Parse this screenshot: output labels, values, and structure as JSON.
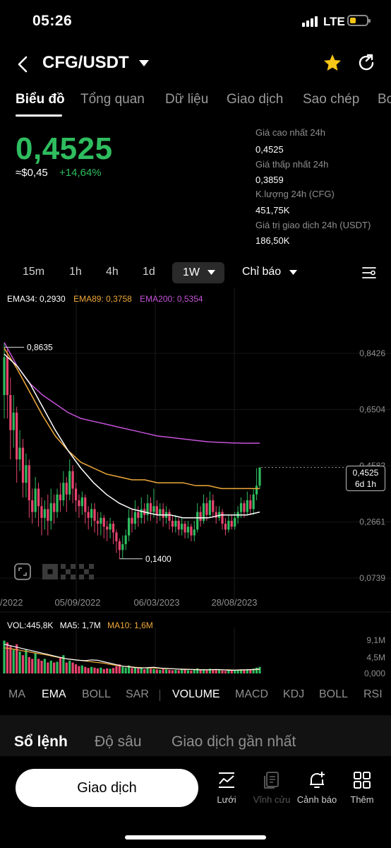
{
  "status_bar": {
    "time": "05:26",
    "network": "LTE",
    "battery_level": 0.35
  },
  "header": {
    "title": "CFG/USDT",
    "icons": [
      "back-icon",
      "chevron-down-icon",
      "star-icon",
      "share-icon"
    ],
    "favorite_color": "#f5c518"
  },
  "tabs": [
    "Biểu đồ",
    "Tổng quan",
    "Dữ liệu",
    "Giao dịch",
    "Sao chép",
    "Bo"
  ],
  "price": {
    "last": "0,4525",
    "fiat": "≈$0,45",
    "change": "+14,64%",
    "color": "#2ebd5f"
  },
  "stats": [
    {
      "label": "Giá cao nhất 24h",
      "value": "0,4525"
    },
    {
      "label": "Giá thấp nhất 24h",
      "value": "0,3859"
    },
    {
      "label": "K.lượng 24h (CFG)",
      "value": "451,75K"
    },
    {
      "label": "Giá trị giao dịch 24h (USDT)",
      "value": "186,50K"
    }
  ],
  "timeframes": [
    "15m",
    "1h",
    "4h",
    "1d"
  ],
  "timeframe_selected": "1W",
  "indicator_button": "Chỉ báo",
  "chart_data": {
    "type": "candlestick",
    "ema_legend": [
      {
        "label": "EMA34: 0,2930",
        "color": "#ffffff"
      },
      {
        "label": "EMA89: 0,3758",
        "color": "#f0a93a"
      },
      {
        "label": "EMA200: 0,5354",
        "color": "#c552d9"
      }
    ],
    "y_ticks": [
      "0,8426",
      "0,6504",
      "0,4582",
      "0,2661",
      "0,0739"
    ],
    "x_ticks": [
      "/2022",
      "05/09/2022",
      "06/03/2023",
      "28/08/2023"
    ],
    "annotations": {
      "high": "0,8635",
      "low": "0,1400"
    },
    "last_price_tag": {
      "price": "0,4525",
      "countdown": "6d 1h"
    },
    "up_color": "#2ebd5f",
    "down_color": "#e8456f",
    "ylim": [
      0.0739,
      0.8426
    ],
    "candles": [
      [
        0.7,
        0.83,
        0.88,
        0.62
      ],
      [
        0.83,
        0.7,
        0.86,
        0.62
      ],
      [
        0.7,
        0.58,
        0.76,
        0.48
      ],
      [
        0.58,
        0.64,
        0.7,
        0.52
      ],
      [
        0.64,
        0.48,
        0.66,
        0.4
      ],
      [
        0.48,
        0.52,
        0.58,
        0.44
      ],
      [
        0.52,
        0.4,
        0.55,
        0.35
      ],
      [
        0.4,
        0.46,
        0.5,
        0.35
      ],
      [
        0.46,
        0.34,
        0.48,
        0.28
      ],
      [
        0.34,
        0.3,
        0.38,
        0.26
      ],
      [
        0.3,
        0.38,
        0.42,
        0.28
      ],
      [
        0.38,
        0.32,
        0.4,
        0.25
      ],
      [
        0.32,
        0.28,
        0.35,
        0.22
      ],
      [
        0.28,
        0.31,
        0.34,
        0.24
      ],
      [
        0.31,
        0.27,
        0.36,
        0.22
      ],
      [
        0.27,
        0.33,
        0.38,
        0.24
      ],
      [
        0.33,
        0.3,
        0.36,
        0.26
      ],
      [
        0.3,
        0.36,
        0.38,
        0.28
      ],
      [
        0.36,
        0.34,
        0.4,
        0.3
      ],
      [
        0.34,
        0.4,
        0.44,
        0.32
      ],
      [
        0.4,
        0.36,
        0.42,
        0.3
      ],
      [
        0.36,
        0.44,
        0.48,
        0.34
      ],
      [
        0.44,
        0.38,
        0.46,
        0.33
      ],
      [
        0.38,
        0.34,
        0.4,
        0.3
      ],
      [
        0.34,
        0.32,
        0.36,
        0.28
      ],
      [
        0.32,
        0.35,
        0.37,
        0.29
      ],
      [
        0.35,
        0.3,
        0.36,
        0.26
      ],
      [
        0.3,
        0.28,
        0.32,
        0.24
      ],
      [
        0.28,
        0.31,
        0.33,
        0.25
      ],
      [
        0.31,
        0.27,
        0.33,
        0.23
      ],
      [
        0.27,
        0.26,
        0.3,
        0.22
      ],
      [
        0.26,
        0.28,
        0.3,
        0.22
      ],
      [
        0.28,
        0.25,
        0.29,
        0.21
      ],
      [
        0.25,
        0.24,
        0.27,
        0.2
      ],
      [
        0.24,
        0.26,
        0.28,
        0.21
      ],
      [
        0.26,
        0.23,
        0.27,
        0.19
      ],
      [
        0.23,
        0.2,
        0.24,
        0.16
      ],
      [
        0.2,
        0.17,
        0.21,
        0.14
      ],
      [
        0.17,
        0.19,
        0.22,
        0.14
      ],
      [
        0.19,
        0.22,
        0.24,
        0.17
      ],
      [
        0.22,
        0.28,
        0.31,
        0.2
      ],
      [
        0.28,
        0.26,
        0.31,
        0.23
      ],
      [
        0.26,
        0.3,
        0.34,
        0.24
      ],
      [
        0.3,
        0.28,
        0.32,
        0.25
      ],
      [
        0.28,
        0.31,
        0.35,
        0.26
      ],
      [
        0.31,
        0.29,
        0.33,
        0.26
      ],
      [
        0.29,
        0.33,
        0.36,
        0.27
      ],
      [
        0.33,
        0.3,
        0.35,
        0.27
      ],
      [
        0.3,
        0.32,
        0.38,
        0.28
      ],
      [
        0.32,
        0.29,
        0.34,
        0.26
      ],
      [
        0.29,
        0.31,
        0.33,
        0.27
      ],
      [
        0.31,
        0.28,
        0.33,
        0.25
      ],
      [
        0.28,
        0.3,
        0.32,
        0.26
      ],
      [
        0.3,
        0.27,
        0.31,
        0.24
      ],
      [
        0.27,
        0.25,
        0.29,
        0.23
      ],
      [
        0.25,
        0.27,
        0.29,
        0.23
      ],
      [
        0.27,
        0.24,
        0.28,
        0.22
      ],
      [
        0.24,
        0.26,
        0.28,
        0.22
      ],
      [
        0.26,
        0.23,
        0.27,
        0.21
      ],
      [
        0.23,
        0.25,
        0.27,
        0.21
      ],
      [
        0.25,
        0.22,
        0.26,
        0.2
      ],
      [
        0.22,
        0.24,
        0.27,
        0.2
      ],
      [
        0.24,
        0.3,
        0.33,
        0.23
      ],
      [
        0.3,
        0.27,
        0.32,
        0.25
      ],
      [
        0.27,
        0.33,
        0.36,
        0.26
      ],
      [
        0.33,
        0.29,
        0.35,
        0.27
      ],
      [
        0.29,
        0.34,
        0.37,
        0.28
      ],
      [
        0.34,
        0.3,
        0.36,
        0.28
      ],
      [
        0.3,
        0.28,
        0.32,
        0.26
      ],
      [
        0.28,
        0.3,
        0.32,
        0.27
      ],
      [
        0.3,
        0.26,
        0.31,
        0.24
      ],
      [
        0.26,
        0.24,
        0.28,
        0.22
      ],
      [
        0.24,
        0.27,
        0.29,
        0.23
      ],
      [
        0.27,
        0.25,
        0.29,
        0.24
      ],
      [
        0.25,
        0.28,
        0.3,
        0.24
      ],
      [
        0.28,
        0.3,
        0.32,
        0.26
      ],
      [
        0.3,
        0.33,
        0.35,
        0.28
      ],
      [
        0.33,
        0.3,
        0.34,
        0.28
      ],
      [
        0.3,
        0.34,
        0.37,
        0.29
      ],
      [
        0.34,
        0.31,
        0.36,
        0.29
      ],
      [
        0.31,
        0.36,
        0.38,
        0.29
      ],
      [
        0.36,
        0.39,
        0.45,
        0.34
      ],
      [
        0.39,
        0.4525,
        0.4525,
        0.38
      ]
    ],
    "ema34": [
      0.84,
      0.8,
      0.74,
      0.66,
      0.58,
      0.51,
      0.45,
      0.4,
      0.36,
      0.33,
      0.31,
      0.3,
      0.29,
      0.29,
      0.28,
      0.28,
      0.28,
      0.29,
      0.29,
      0.29,
      0.3
    ],
    "ema89": [
      0.86,
      0.79,
      0.71,
      0.63,
      0.56,
      0.51,
      0.47,
      0.45,
      0.43,
      0.42,
      0.41,
      0.41,
      0.4,
      0.4,
      0.4,
      0.39,
      0.39,
      0.38,
      0.38,
      0.38,
      0.38
    ],
    "ema200": [
      0.88,
      0.8,
      0.74,
      0.7,
      0.67,
      0.64,
      0.62,
      0.61,
      0.6,
      0.59,
      0.58,
      0.57,
      0.56,
      0.555,
      0.55,
      0.545,
      0.54,
      0.538,
      0.536,
      0.535,
      0.5354
    ],
    "volume_legend": [
      {
        "label": "VOL:445,8K",
        "color": "#ffffff"
      },
      {
        "label": "MA5: 1,7M",
        "color": "#ffffff"
      },
      {
        "label": "MA10: 1,6M",
        "color": "#f0a93a"
      }
    ],
    "volume_ticks": [
      "9,1M",
      "4,5M",
      "0,000"
    ],
    "volume_max": 9.1,
    "volumes": [
      9.0,
      8.5,
      7.5,
      6.5,
      8.0,
      6.0,
      5.0,
      6.5,
      4.5,
      4.0,
      5.5,
      4.0,
      3.5,
      4.0,
      3.0,
      3.5,
      3.0,
      3.2,
      4.5,
      5.0,
      3.0,
      3.5,
      3.0,
      2.5,
      2.0,
      2.2,
      1.8,
      1.5,
      1.8,
      1.6,
      1.4,
      1.6,
      1.2,
      1.4,
      1.3,
      1.5,
      2.0,
      2.5,
      1.8,
      1.6,
      2.2,
      1.5,
      1.6,
      1.4,
      1.5,
      1.2,
      1.4,
      1.3,
      1.2,
      1.1,
      1.0,
      1.2,
      1.1,
      1.0,
      0.9,
      1.0,
      0.9,
      1.1,
      1.0,
      0.9,
      0.8,
      1.0,
      1.4,
      1.0,
      1.2,
      1.0,
      1.3,
      1.0,
      0.9,
      1.0,
      0.8,
      0.7,
      0.9,
      0.8,
      0.9,
      1.0,
      1.1,
      0.9,
      1.2,
      1.0,
      1.3,
      1.6,
      1.8
    ],
    "vol_ma5": [
      8.0,
      7.6,
      7.2,
      6.8,
      6.4,
      6.0,
      5.6,
      5.2,
      4.8,
      4.4,
      4.0,
      3.8,
      3.6,
      3.5,
      3.7,
      3.6,
      3.2,
      2.8,
      2.4,
      2.0,
      1.8,
      1.6,
      1.5,
      1.6,
      1.7,
      1.5,
      1.4,
      1.3,
      1.2,
      1.1,
      1.1,
      1.0,
      1.0,
      1.0,
      1.1,
      1.0,
      0.9,
      0.9,
      1.0,
      1.0,
      1.1,
      1.2
    ],
    "vol_ma10": [
      7.0,
      6.8,
      6.5,
      6.2,
      5.9,
      5.6,
      5.3,
      5.0,
      4.6,
      4.3,
      4.0,
      3.8,
      3.6,
      3.4,
      3.2,
      3.0,
      2.8,
      2.5,
      2.2,
      2.0,
      1.9,
      1.7,
      1.6,
      1.5,
      1.5,
      1.4,
      1.3,
      1.3,
      1.2,
      1.2,
      1.1,
      1.1,
      1.0,
      1.0,
      1.0,
      1.0,
      1.0,
      0.9,
      0.9,
      1.0,
      1.0,
      1.1
    ]
  },
  "indicator_tabs": [
    {
      "label": "MA",
      "on": false
    },
    {
      "label": "EMA",
      "on": true
    },
    {
      "label": "BOLL",
      "on": false
    },
    {
      "label": "SAR",
      "on": false
    },
    {
      "label": "VOLUME",
      "on": true
    },
    {
      "label": "MACD",
      "on": false
    },
    {
      "label": "KDJ",
      "on": false
    },
    {
      "label": "BOLL",
      "on": false
    },
    {
      "label": "RSI",
      "on": false
    }
  ],
  "order_tabs": [
    "Sổ lệnh",
    "Độ sâu",
    "Giao dịch gần nhất"
  ],
  "bottom_bar": {
    "trade_button": "Giao dịch",
    "items": [
      {
        "label": "Lưới",
        "icon": "grid-trading-icon"
      },
      {
        "label": "Vĩnh cửu",
        "icon": "perpetual-icon"
      },
      {
        "label": "Cảnh báo",
        "icon": "alert-bell-icon"
      },
      {
        "label": "Thêm",
        "icon": "more-grid-icon"
      }
    ]
  }
}
